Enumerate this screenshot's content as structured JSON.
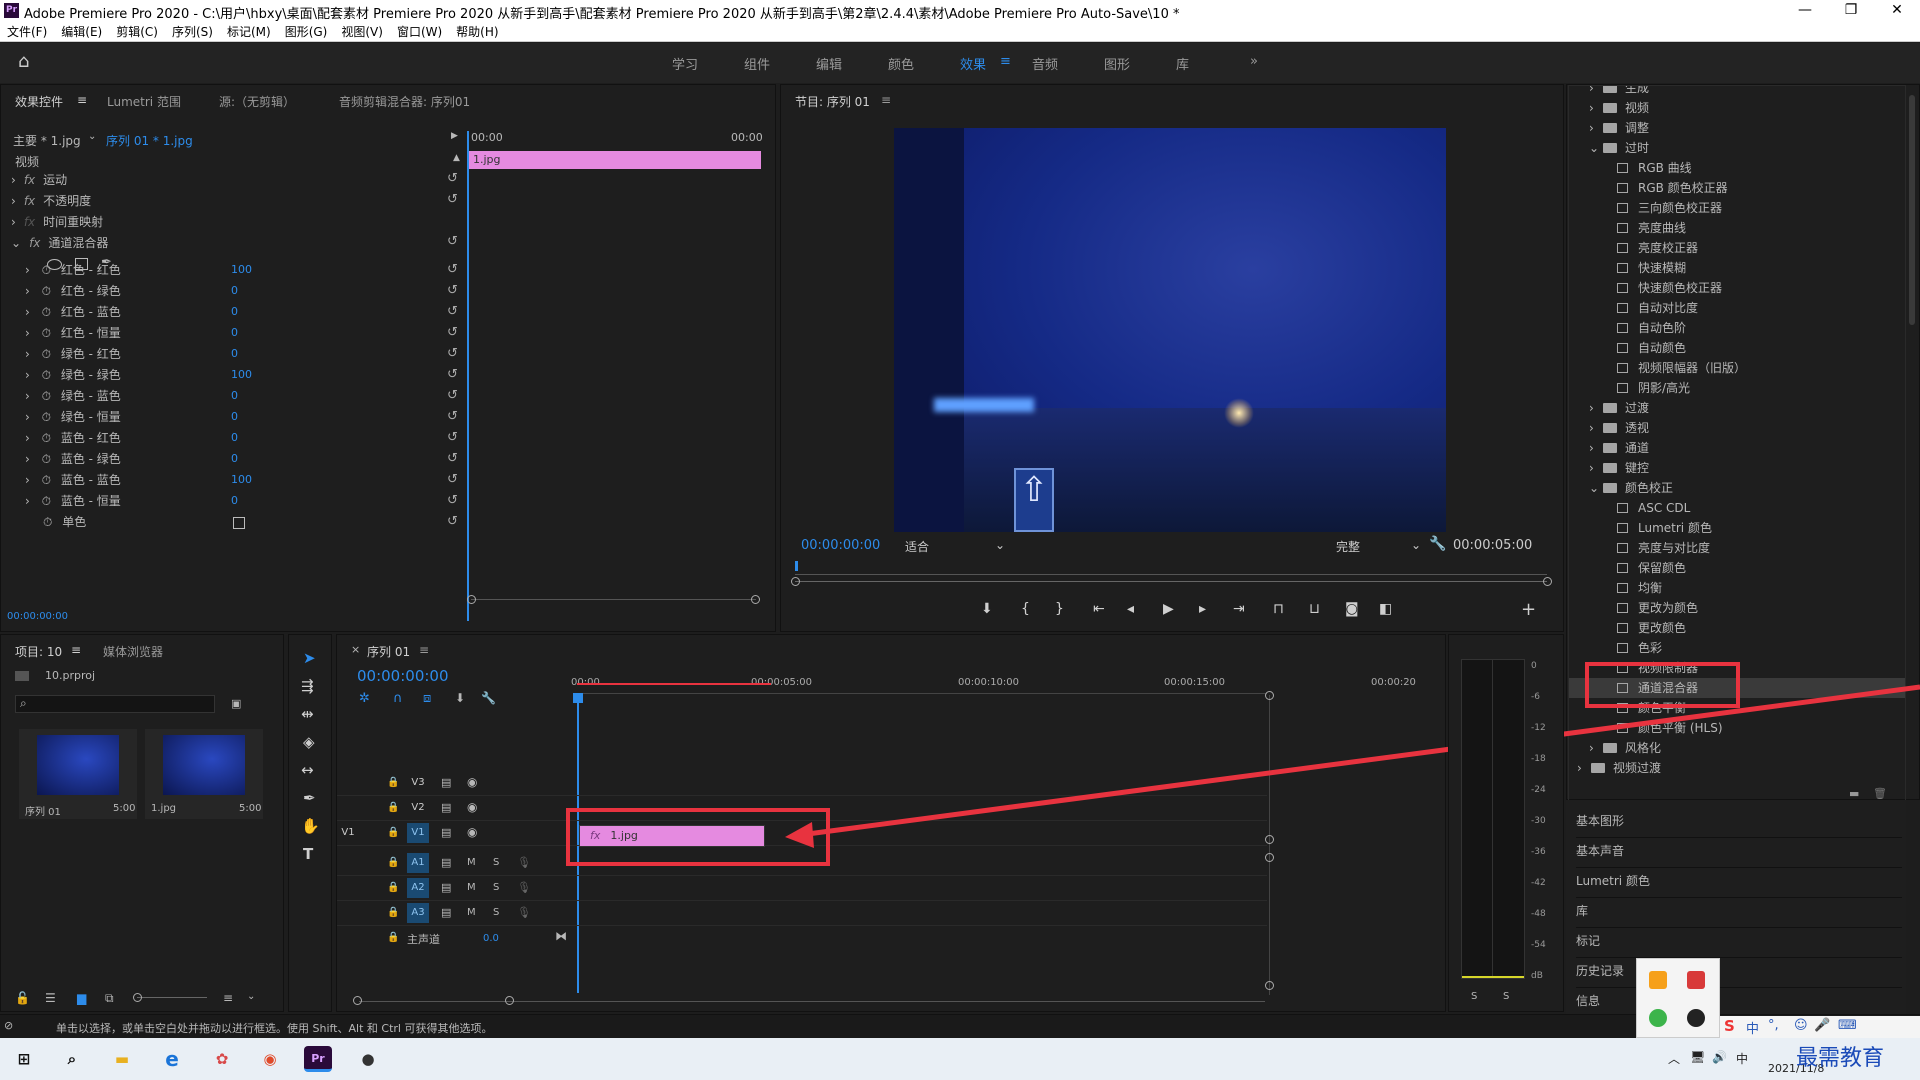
{
  "window": {
    "title": "Adobe Premiere Pro 2020 - C:\\用户\\hbxy\\桌面\\配套素材 Premiere Pro 2020 从新手到高手\\配套素材 Premiere Pro 2020 从新手到高手\\第2章\\2.4.4\\素材\\Adobe Premiere Pro Auto-Save\\10 *",
    "app_icon": "Pr",
    "minimize": "—",
    "maximize": "❐",
    "close": "✕"
  },
  "menu": [
    "文件(F)",
    "编辑(E)",
    "剪辑(C)",
    "序列(S)",
    "标记(M)",
    "图形(G)",
    "视图(V)",
    "窗口(W)",
    "帮助(H)"
  ],
  "workspaces": {
    "items": [
      "学习",
      "组件",
      "编辑",
      "颜色",
      "效果",
      "音频",
      "图形",
      "库"
    ],
    "active": "效果",
    "more": "»"
  },
  "effect_controls": {
    "tabs": [
      "效果控件",
      "Lumetri 范围",
      "源:（无剪辑）",
      "音频剪辑混合器: 序列01"
    ],
    "master": "主要 * 1.jpg",
    "sequence": "序列 01 * 1.jpg",
    "time_start": "00:00",
    "time_end": "00:00",
    "clip": "1.jpg",
    "video_label": "视频",
    "effects": [
      "运动",
      "不透明度",
      "时间重映射",
      "通道混合器"
    ],
    "params": [
      {
        "name": "红色 - 红色",
        "value": "100"
      },
      {
        "name": "红色 - 绿色",
        "value": "0"
      },
      {
        "name": "红色 - 蓝色",
        "value": "0"
      },
      {
        "name": "红色 - 恒量",
        "value": "0"
      },
      {
        "name": "绿色 - 红色",
        "value": "0"
      },
      {
        "name": "绿色 - 绿色",
        "value": "100"
      },
      {
        "name": "绿色 - 蓝色",
        "value": "0"
      },
      {
        "name": "绿色 - 恒量",
        "value": "0"
      },
      {
        "name": "蓝色 - 红色",
        "value": "0"
      },
      {
        "name": "蓝色 - 绿色",
        "value": "0"
      },
      {
        "name": "蓝色 - 蓝色",
        "value": "100"
      },
      {
        "name": "蓝色 - 恒量",
        "value": "0"
      }
    ],
    "mono": "单色",
    "timecode": "00:00:00:00"
  },
  "program": {
    "title": "节目: 序列 01",
    "timecode": "00:00:00:00",
    "fit": "适合",
    "quality": "完整",
    "duration": "00:00:05:00"
  },
  "effects_tree": {
    "items": [
      {
        "label": "生成",
        "kind": "folder",
        "level": 1
      },
      {
        "label": "视频",
        "kind": "folder",
        "level": 1
      },
      {
        "label": "调整",
        "kind": "folder",
        "level": 1
      },
      {
        "label": "过时",
        "kind": "folder-open",
        "level": 1
      },
      {
        "label": "RGB 曲线",
        "kind": "fx",
        "level": 2
      },
      {
        "label": "RGB 颜色校正器",
        "kind": "fx",
        "level": 2
      },
      {
        "label": "三向颜色校正器",
        "kind": "fx",
        "level": 2
      },
      {
        "label": "亮度曲线",
        "kind": "fx",
        "level": 2
      },
      {
        "label": "亮度校正器",
        "kind": "fx",
        "level": 2
      },
      {
        "label": "快速模糊",
        "kind": "fx",
        "level": 2
      },
      {
        "label": "快速颜色校正器",
        "kind": "fx",
        "level": 2
      },
      {
        "label": "自动对比度",
        "kind": "fx",
        "level": 2
      },
      {
        "label": "自动色阶",
        "kind": "fx",
        "level": 2
      },
      {
        "label": "自动颜色",
        "kind": "fx",
        "level": 2
      },
      {
        "label": "视频限幅器（旧版）",
        "kind": "fx",
        "level": 2
      },
      {
        "label": "阴影/高光",
        "kind": "fx",
        "level": 2
      },
      {
        "label": "过渡",
        "kind": "folder",
        "level": 1
      },
      {
        "label": "透视",
        "kind": "folder",
        "level": 1
      },
      {
        "label": "通道",
        "kind": "folder",
        "level": 1
      },
      {
        "label": "键控",
        "kind": "folder",
        "level": 1
      },
      {
        "label": "颜色校正",
        "kind": "folder-open",
        "level": 1
      },
      {
        "label": "ASC CDL",
        "kind": "fx",
        "level": 2
      },
      {
        "label": "Lumetri 颜色",
        "kind": "fx",
        "level": 2
      },
      {
        "label": "亮度与对比度",
        "kind": "fx",
        "level": 2
      },
      {
        "label": "保留颜色",
        "kind": "fx",
        "level": 2
      },
      {
        "label": "均衡",
        "kind": "fx",
        "level": 2
      },
      {
        "label": "更改为颜色",
        "kind": "fx",
        "level": 2
      },
      {
        "label": "更改颜色",
        "kind": "fx",
        "level": 2
      },
      {
        "label": "色彩",
        "kind": "fx",
        "level": 2
      },
      {
        "label": "视频限制器",
        "kind": "fx",
        "level": 2
      },
      {
        "label": "通道混合器",
        "kind": "fx",
        "level": 2,
        "selected": true
      },
      {
        "label": "颜色平衡",
        "kind": "fx",
        "level": 2
      },
      {
        "label": "颜色平衡 (HLS)",
        "kind": "fx",
        "level": 2
      },
      {
        "label": "风格化",
        "kind": "folder",
        "level": 1
      },
      {
        "label": "视频过渡",
        "kind": "folder",
        "level": 0
      }
    ]
  },
  "side_panels": [
    "基本图形",
    "基本声音",
    "Lumetri 颜色",
    "库",
    "标记",
    "历史记录",
    "信息"
  ],
  "project": {
    "tabs": [
      "项目: 10",
      "媒体浏览器"
    ],
    "file": "10.prproj",
    "search_placeholder": "",
    "items": [
      {
        "name": "序列 01",
        "duration": "5:00"
      },
      {
        "name": "1.jpg",
        "duration": "5:00"
      }
    ]
  },
  "timeline": {
    "tab": "序列 01",
    "timecode": "00:00:00:00",
    "ruler": [
      "00:00",
      "00:00:05:00",
      "00:00:10:00",
      "00:00:15:00",
      "00:00:20"
    ],
    "video_tracks": [
      "V3",
      "V2",
      "V1"
    ],
    "source_patch": "V1",
    "audio_tracks": [
      "A1",
      "A2",
      "A3"
    ],
    "mute": "M",
    "solo": "S",
    "master": "主声道",
    "master_value": "0.0",
    "clip": "1.jpg",
    "clip_fx": "fx"
  },
  "meter": {
    "scale": [
      "0",
      "-6",
      "-12",
      "-18",
      "-24",
      "-30",
      "-36",
      "-42",
      "-48",
      "-54",
      "dB"
    ],
    "solo": [
      "S",
      "S"
    ]
  },
  "status": "单击以选择，或单击空白处并拖动以进行框选。使用 Shift、Alt 和 Ctrl 可获得其他选项。",
  "tray": {
    "ime": "中",
    "date": "2021/11/8",
    "watermark": "最需教育"
  },
  "colors": {
    "accent": "#2d8ceb",
    "clip": "#e58ae0",
    "highlight": "#e8333f",
    "panel": "#1e1e1e"
  }
}
